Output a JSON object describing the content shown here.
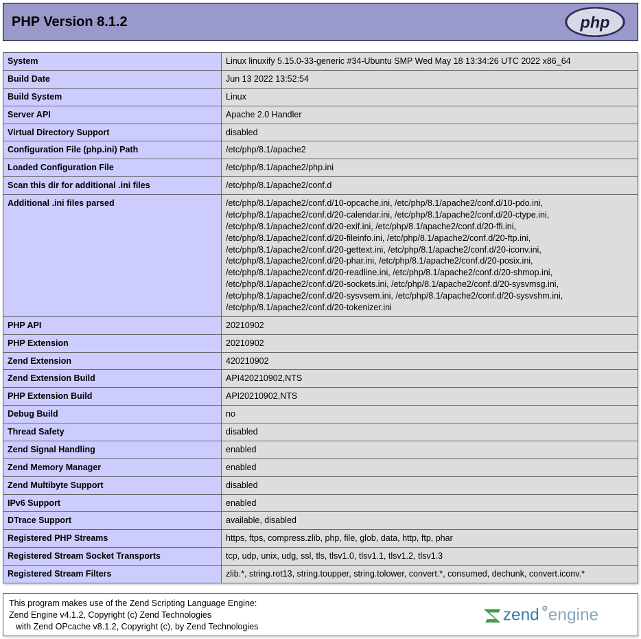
{
  "header": {
    "title": "PHP Version 8.1.2"
  },
  "rows": [
    {
      "label": "System",
      "value": "Linux linuxify 5.15.0-33-generic #34-Ubuntu SMP Wed May 18 13:34:26 UTC 2022 x86_64"
    },
    {
      "label": "Build Date",
      "value": "Jun 13 2022 13:52:54"
    },
    {
      "label": "Build System",
      "value": "Linux"
    },
    {
      "label": "Server API",
      "value": "Apache 2.0 Handler"
    },
    {
      "label": "Virtual Directory Support",
      "value": "disabled"
    },
    {
      "label": "Configuration File (php.ini) Path",
      "value": "/etc/php/8.1/apache2"
    },
    {
      "label": "Loaded Configuration File",
      "value": "/etc/php/8.1/apache2/php.ini"
    },
    {
      "label": "Scan this dir for additional .ini files",
      "value": "/etc/php/8.1/apache2/conf.d"
    },
    {
      "label": "Additional .ini files parsed",
      "value": "/etc/php/8.1/apache2/conf.d/10-opcache.ini, /etc/php/8.1/apache2/conf.d/10-pdo.ini, /etc/php/8.1/apache2/conf.d/20-calendar.ini, /etc/php/8.1/apache2/conf.d/20-ctype.ini, /etc/php/8.1/apache2/conf.d/20-exif.ini, /etc/php/8.1/apache2/conf.d/20-ffi.ini, /etc/php/8.1/apache2/conf.d/20-fileinfo.ini, /etc/php/8.1/apache2/conf.d/20-ftp.ini, /etc/php/8.1/apache2/conf.d/20-gettext.ini, /etc/php/8.1/apache2/conf.d/20-iconv.ini, /etc/php/8.1/apache2/conf.d/20-phar.ini, /etc/php/8.1/apache2/conf.d/20-posix.ini, /etc/php/8.1/apache2/conf.d/20-readline.ini, /etc/php/8.1/apache2/conf.d/20-shmop.ini, /etc/php/8.1/apache2/conf.d/20-sockets.ini, /etc/php/8.1/apache2/conf.d/20-sysvmsg.ini, /etc/php/8.1/apache2/conf.d/20-sysvsem.ini, /etc/php/8.1/apache2/conf.d/20-sysvshm.ini, /etc/php/8.1/apache2/conf.d/20-tokenizer.ini"
    },
    {
      "label": "PHP API",
      "value": "20210902"
    },
    {
      "label": "PHP Extension",
      "value": "20210902"
    },
    {
      "label": "Zend Extension",
      "value": "420210902"
    },
    {
      "label": "Zend Extension Build",
      "value": "API420210902,NTS"
    },
    {
      "label": "PHP Extension Build",
      "value": "API20210902,NTS"
    },
    {
      "label": "Debug Build",
      "value": "no"
    },
    {
      "label": "Thread Safety",
      "value": "disabled"
    },
    {
      "label": "Zend Signal Handling",
      "value": "enabled"
    },
    {
      "label": "Zend Memory Manager",
      "value": "enabled"
    },
    {
      "label": "Zend Multibyte Support",
      "value": "disabled"
    },
    {
      "label": "IPv6 Support",
      "value": "enabled"
    },
    {
      "label": "DTrace Support",
      "value": "available, disabled"
    },
    {
      "label": "Registered PHP Streams",
      "value": "https, ftps, compress.zlib, php, file, glob, data, http, ftp, phar"
    },
    {
      "label": "Registered Stream Socket Transports",
      "value": "tcp, udp, unix, udg, ssl, tls, tlsv1.0, tlsv1.1, tlsv1.2, tlsv1.3"
    },
    {
      "label": "Registered Stream Filters",
      "value": "zlib.*, string.rot13, string.toupper, string.tolower, convert.*, consumed, dechunk, convert.iconv.*"
    }
  ],
  "footer": {
    "line1": "This program makes use of the Zend Scripting Language Engine:",
    "line2": "Zend Engine v4.1.2, Copyright (c) Zend Technologies",
    "line3": "with Zend OPcache v8.1.2, Copyright (c), by Zend Technologies"
  }
}
